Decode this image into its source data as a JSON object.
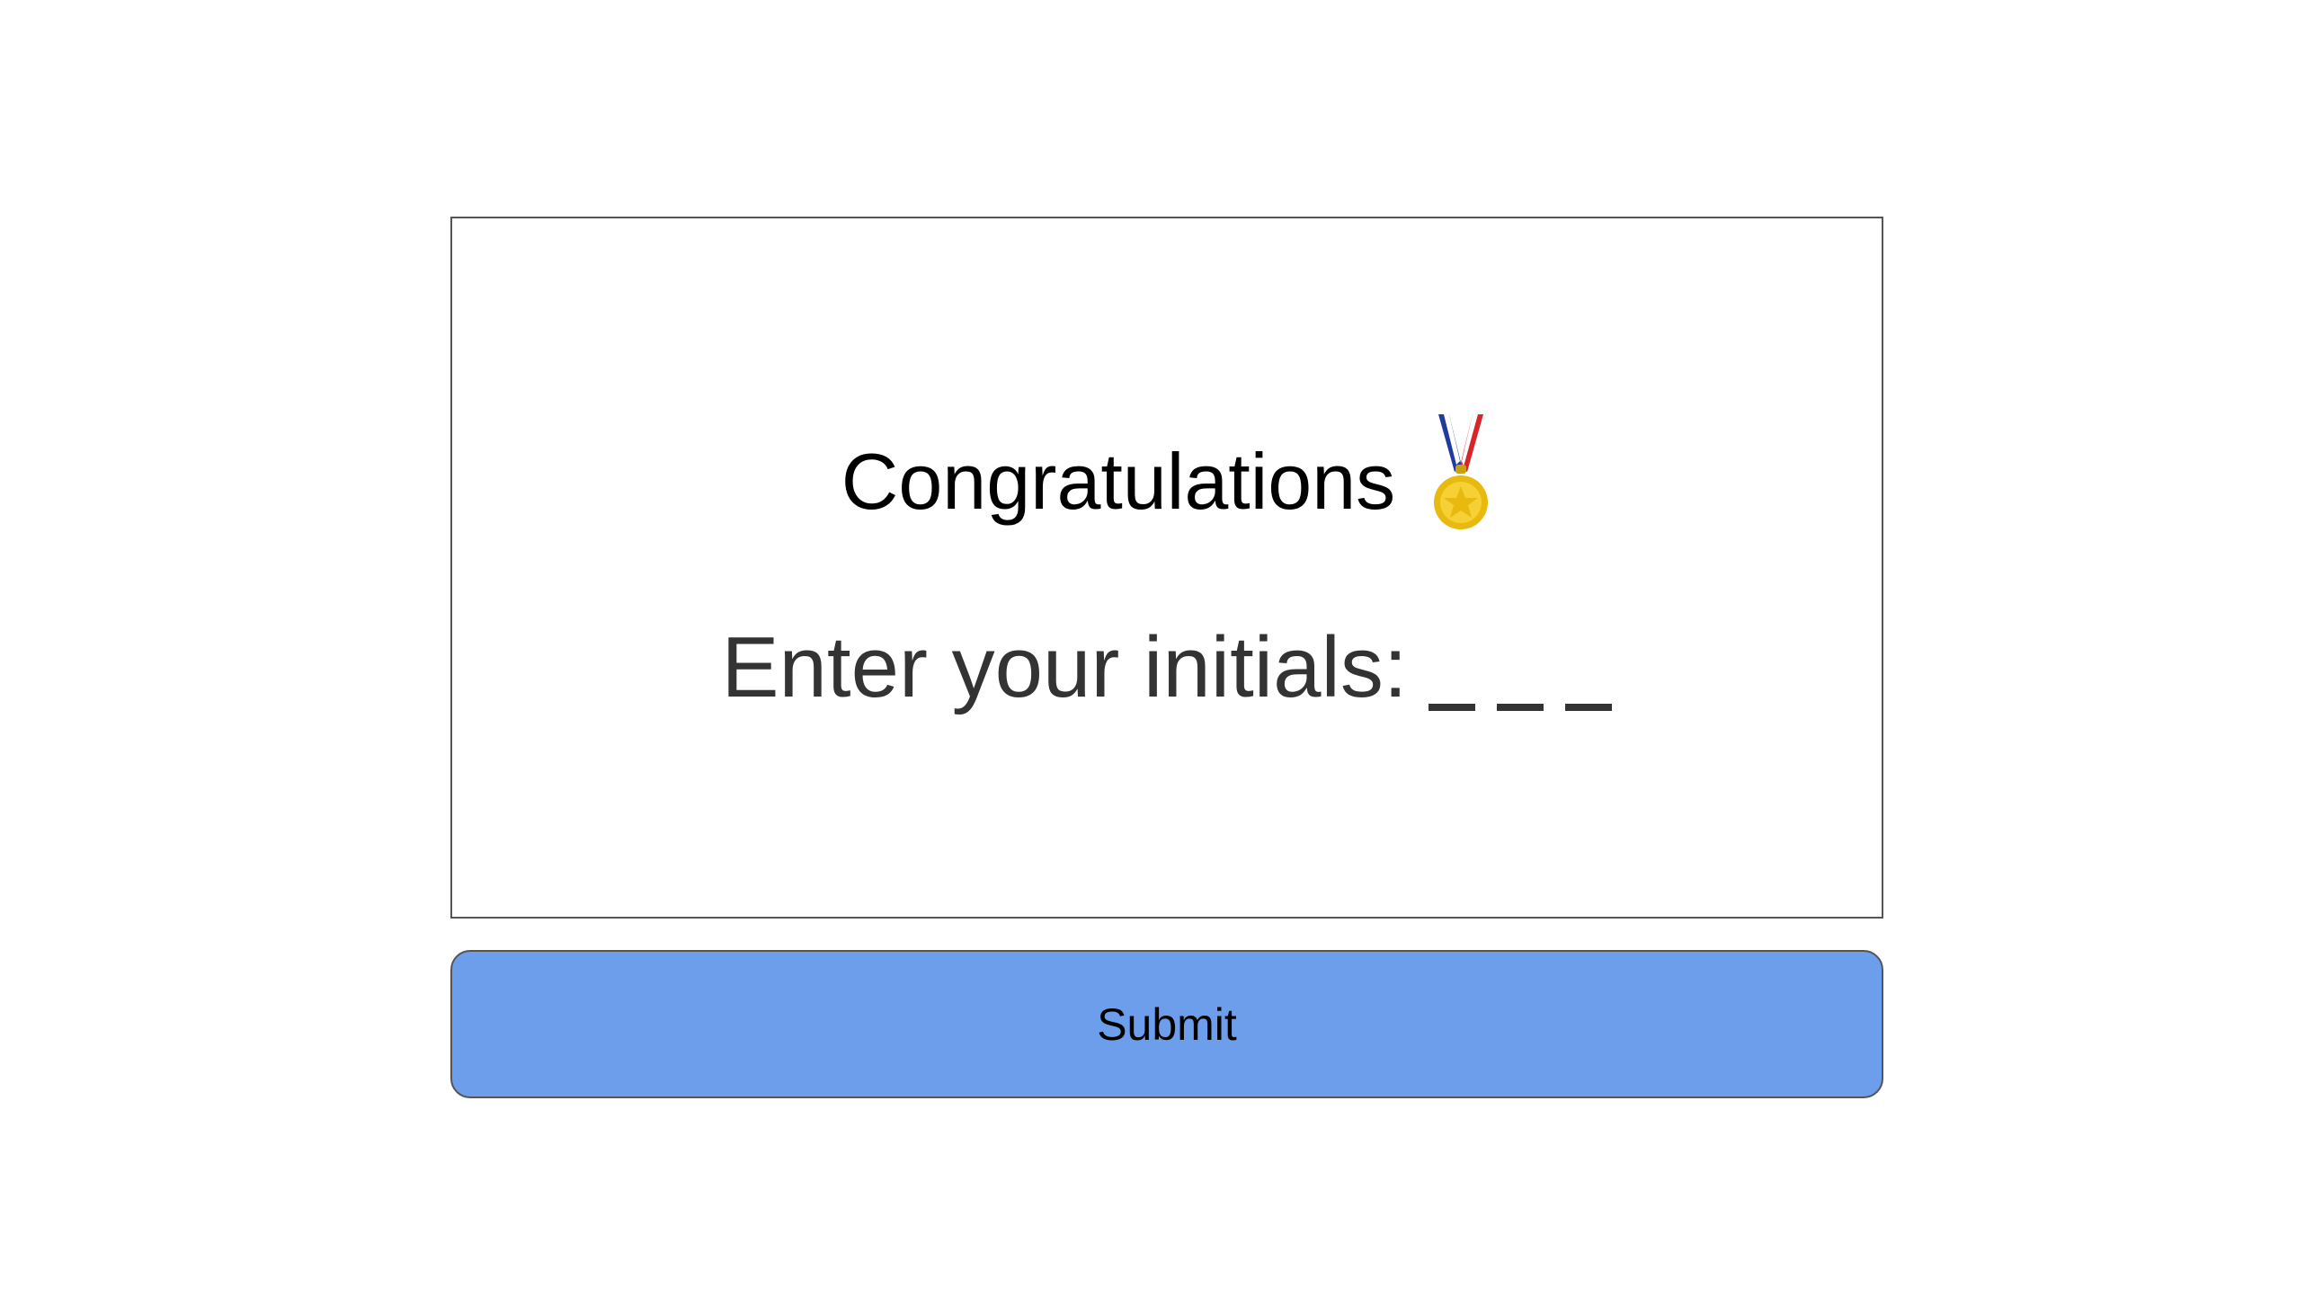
{
  "dialog": {
    "title": "Congratulations",
    "title_icon": "medal-icon",
    "prompt": "Enter your initials:",
    "initials": [
      "",
      "",
      ""
    ]
  },
  "submit": {
    "label": "Submit"
  },
  "colors": {
    "button_bg": "#6d9eeb",
    "border": "#555555",
    "prompt_text": "#333333"
  }
}
